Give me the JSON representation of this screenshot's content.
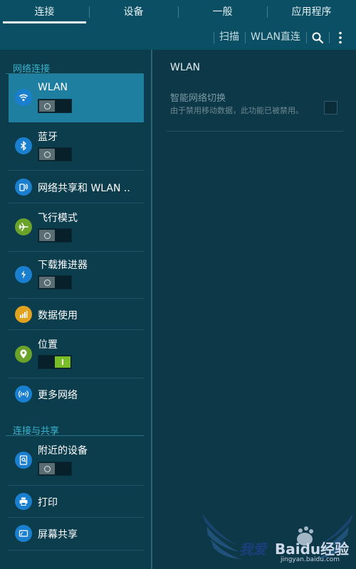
{
  "tabs": [
    {
      "label": "连接",
      "active": true
    },
    {
      "label": "设备",
      "active": false
    },
    {
      "label": "一般",
      "active": false
    },
    {
      "label": "应用程序",
      "active": false
    }
  ],
  "actionbar": {
    "scan": "扫描",
    "wifi_direct": "WLAN直连",
    "search_icon": "search-icon",
    "more_icon": "more-vertical-icon"
  },
  "sections": {
    "network": "网络连接",
    "share": "连接与共享"
  },
  "items": [
    {
      "label": "WLAN",
      "icon": "wifi-icon",
      "color": "#1b7fd0",
      "toggle": "off"
    },
    {
      "label": "蓝牙",
      "icon": "bluetooth-icon",
      "color": "#1b7fd0",
      "toggle": "off"
    },
    {
      "label": "网络共享和 WLAN ..",
      "icon": "hotspot-icon",
      "color": "#1b7fd0",
      "toggle": null
    },
    {
      "label": "飞行模式",
      "icon": "airplane-icon",
      "color": "#6aa22a",
      "toggle": "off"
    },
    {
      "label": "下载推进器",
      "icon": "download-booster-icon",
      "color": "#1b7fd0",
      "toggle": "off"
    },
    {
      "label": "数据使用",
      "icon": "data-usage-icon",
      "color": "#e0a21f",
      "toggle": null
    },
    {
      "label": "位置",
      "icon": "location-icon",
      "color": "#6aa22a",
      "toggle": "on"
    },
    {
      "label": "更多网络",
      "icon": "more-networks-icon",
      "color": "#1b7fd0",
      "toggle": null
    },
    {
      "label": "附近的设备",
      "icon": "nearby-devices-icon",
      "color": "#1b7fd0",
      "toggle": "off"
    },
    {
      "label": "打印",
      "icon": "print-icon",
      "color": "#1b7fd0",
      "toggle": null
    },
    {
      "label": "屏幕共享",
      "icon": "screen-mirroring-icon",
      "color": "#1b7fd0",
      "toggle": null
    }
  ],
  "detail": {
    "title": "WLAN",
    "option_title": "智能网络切换",
    "option_desc": "由于禁用移动数据，此功能已被禁用。",
    "checked": false
  },
  "watermark": {
    "text": "我爱",
    "brand": "Baidu经验",
    "url": "jingyan.baidu.com"
  },
  "colors": {
    "selected_item": "#1e7fa0",
    "toggle_on": "#79be27",
    "section_header": "#3bb5d0"
  }
}
